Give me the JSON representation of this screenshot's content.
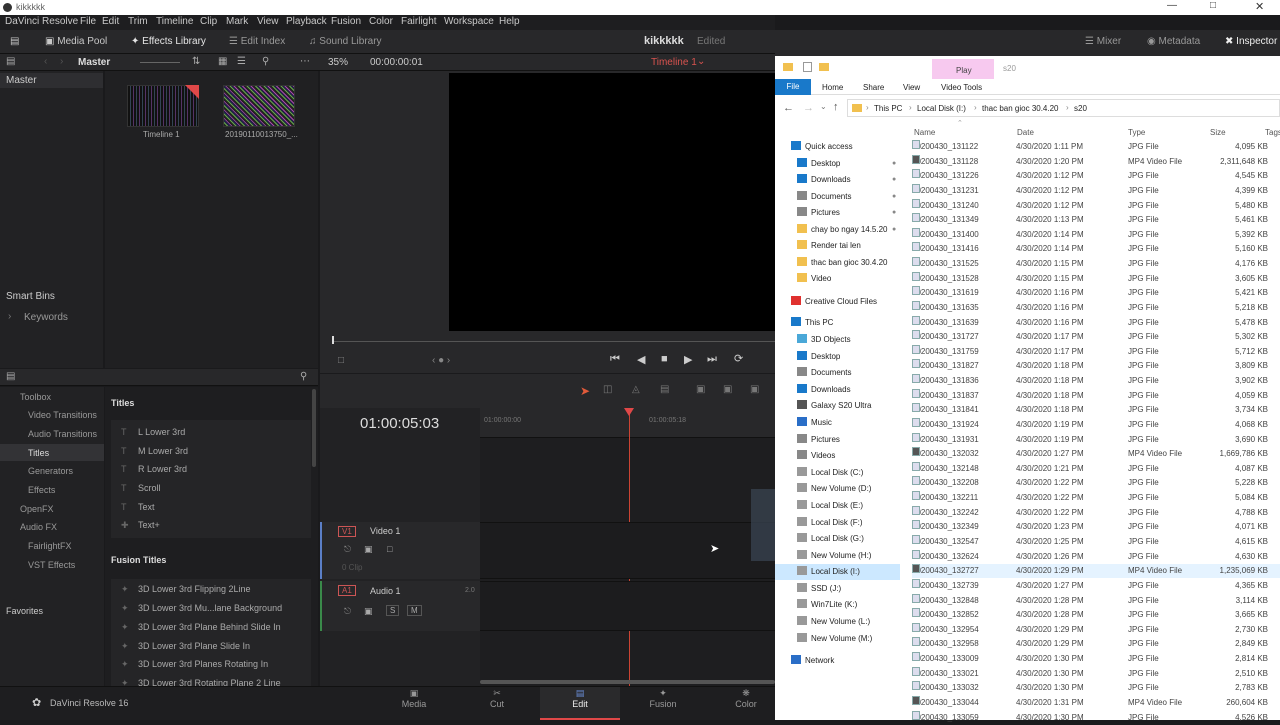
{
  "window_title": "kikkkkk",
  "menu": [
    "DaVinci Resolve",
    "File",
    "Edit",
    "Trim",
    "Timeline",
    "Clip",
    "Mark",
    "View",
    "Playback",
    "Fusion",
    "Color",
    "Fairlight",
    "Workspace",
    "Help"
  ],
  "toolbar": {
    "media_pool": "Media Pool",
    "effects_library": "Effects Library",
    "edit_index": "Edit Index",
    "sound_library": "Sound Library",
    "project_name": "kikkkkk",
    "project_status": "Edited",
    "mixer": "Mixer",
    "metadata": "Metadata",
    "inspector": "Inspector"
  },
  "mediapool": {
    "bin": "Master",
    "zoom": "35%",
    "timecode": "00:00:00:01",
    "timeline_name": "Timeline 1",
    "tree_master": "Master",
    "clip1": "Timeline 1",
    "clip2": "20190110013750_...",
    "smart_bins": "Smart Bins",
    "keywords": "Keywords"
  },
  "effects": {
    "toolbox": "Toolbox",
    "video_transitions": "Video Transitions",
    "audio_transitions": "Audio Transitions",
    "titles": "Titles",
    "generators": "Generators",
    "effects": "Effects",
    "openfx": "OpenFX",
    "audiofx": "Audio FX",
    "fairlightfx": "FairlightFX",
    "vst": "VST Effects",
    "favorites": "Favorites",
    "titles_header": "Titles",
    "title_items": [
      "L Lower 3rd",
      "M Lower 3rd",
      "R Lower 3rd",
      "Scroll",
      "Text",
      "Text+"
    ],
    "fusion_header": "Fusion Titles",
    "fusion_items": [
      "3D Lower 3rd Flipping 2Line",
      "3D Lower 3rd Mu...lane Background",
      "3D Lower 3rd Plane Behind Slide In",
      "3D Lower 3rd Plane Slide In",
      "3D Lower 3rd Planes Rotating In",
      "3D Lower 3rd Rotating Plane 2 Line"
    ]
  },
  "timeline": {
    "timecode": "01:00:05:03",
    "ruler_start": "01:00:00:00",
    "ruler_mark": "01:00:05:18",
    "v1": "V1",
    "video1": "Video 1",
    "clips_count": "0 Clip",
    "a1": "A1",
    "audio1": "Audio 1",
    "audio_level": "2.0",
    "s_btn": "S",
    "m_btn": "M"
  },
  "pages": [
    "Media",
    "Cut",
    "Edit",
    "Fusion",
    "Color"
  ],
  "app_name": "DaVinci Resolve 16",
  "explorer": {
    "ribbon_tab_play": "Play",
    "ribbon_context": "s20",
    "tabs": [
      "File",
      "Home",
      "Share",
      "View",
      "Video Tools"
    ],
    "path": [
      "This PC",
      "Local Disk (I:)",
      "thac ban gioc 30.4.20",
      "s20"
    ],
    "columns": [
      "Name",
      "Date",
      "Type",
      "Size",
      "Tags"
    ],
    "nav": [
      "Quick access",
      "Desktop",
      "Downloads",
      "Documents",
      "Pictures",
      "chay bo ngay 14.5.20",
      "Render tai len",
      "thac ban gioc 30.4.20",
      "Video",
      "Creative Cloud Files",
      "This PC",
      "3D Objects",
      "Desktop",
      "Documents",
      "Downloads",
      "Galaxy S20 Ultra",
      "Music",
      "Pictures",
      "Videos",
      "Local Disk (C:)",
      "New Volume (D:)",
      "Local Disk (E:)",
      "Local Disk (F:)",
      "Local Disk (G:)",
      "New Volume (H:)",
      "Local Disk (I:)",
      "SSD (J:)",
      "Win7Lite (K:)",
      "New Volume (L:)",
      "New Volume (M:)",
      "Network"
    ],
    "files": [
      [
        "20200430_131122",
        "4/30/2020 1:11 PM",
        "JPG File",
        "4,095 KB"
      ],
      [
        "20200430_131128",
        "4/30/2020 1:20 PM",
        "MP4 Video File",
        "2,311,648 KB"
      ],
      [
        "20200430_131226",
        "4/30/2020 1:12 PM",
        "JPG File",
        "4,545 KB"
      ],
      [
        "20200430_131231",
        "4/30/2020 1:12 PM",
        "JPG File",
        "4,399 KB"
      ],
      [
        "20200430_131240",
        "4/30/2020 1:12 PM",
        "JPG File",
        "5,480 KB"
      ],
      [
        "20200430_131349",
        "4/30/2020 1:13 PM",
        "JPG File",
        "5,461 KB"
      ],
      [
        "20200430_131400",
        "4/30/2020 1:14 PM",
        "JPG File",
        "5,392 KB"
      ],
      [
        "20200430_131416",
        "4/30/2020 1:14 PM",
        "JPG File",
        "5,160 KB"
      ],
      [
        "20200430_131525",
        "4/30/2020 1:15 PM",
        "JPG File",
        "4,176 KB"
      ],
      [
        "20200430_131528",
        "4/30/2020 1:15 PM",
        "JPG File",
        "3,605 KB"
      ],
      [
        "20200430_131619",
        "4/30/2020 1:16 PM",
        "JPG File",
        "5,421 KB"
      ],
      [
        "20200430_131635",
        "4/30/2020 1:16 PM",
        "JPG File",
        "5,218 KB"
      ],
      [
        "20200430_131639",
        "4/30/2020 1:16 PM",
        "JPG File",
        "5,478 KB"
      ],
      [
        "20200430_131727",
        "4/30/2020 1:17 PM",
        "JPG File",
        "5,302 KB"
      ],
      [
        "20200430_131759",
        "4/30/2020 1:17 PM",
        "JPG File",
        "5,712 KB"
      ],
      [
        "20200430_131827",
        "4/30/2020 1:18 PM",
        "JPG File",
        "3,809 KB"
      ],
      [
        "20200430_131836",
        "4/30/2020 1:18 PM",
        "JPG File",
        "3,902 KB"
      ],
      [
        "20200430_131837",
        "4/30/2020 1:18 PM",
        "JPG File",
        "4,059 KB"
      ],
      [
        "20200430_131841",
        "4/30/2020 1:18 PM",
        "JPG File",
        "3,734 KB"
      ],
      [
        "20200430_131924",
        "4/30/2020 1:19 PM",
        "JPG File",
        "4,068 KB"
      ],
      [
        "20200430_131931",
        "4/30/2020 1:19 PM",
        "JPG File",
        "3,690 KB"
      ],
      [
        "20200430_132032",
        "4/30/2020 1:27 PM",
        "MP4 Video File",
        "1,669,786 KB"
      ],
      [
        "20200430_132148",
        "4/30/2020 1:21 PM",
        "JPG File",
        "4,087 KB"
      ],
      [
        "20200430_132208",
        "4/30/2020 1:22 PM",
        "JPG File",
        "5,228 KB"
      ],
      [
        "20200430_132211",
        "4/30/2020 1:22 PM",
        "JPG File",
        "5,084 KB"
      ],
      [
        "20200430_132242",
        "4/30/2020 1:22 PM",
        "JPG File",
        "4,788 KB"
      ],
      [
        "20200430_132349",
        "4/30/2020 1:23 PM",
        "JPG File",
        "4,071 KB"
      ],
      [
        "20200430_132547",
        "4/30/2020 1:25 PM",
        "JPG File",
        "4,615 KB"
      ],
      [
        "20200430_132624",
        "4/30/2020 1:26 PM",
        "JPG File",
        "4,630 KB"
      ],
      [
        "20200430_132727",
        "4/30/2020 1:29 PM",
        "MP4 Video File",
        "1,235,069 KB"
      ],
      [
        "20200430_132739",
        "4/30/2020 1:27 PM",
        "JPG File",
        "4,365 KB"
      ],
      [
        "20200430_132848",
        "4/30/2020 1:28 PM",
        "JPG File",
        "3,114 KB"
      ],
      [
        "20200430_132852",
        "4/30/2020 1:28 PM",
        "JPG File",
        "3,665 KB"
      ],
      [
        "20200430_132954",
        "4/30/2020 1:29 PM",
        "JPG File",
        "2,730 KB"
      ],
      [
        "20200430_132958",
        "4/30/2020 1:29 PM",
        "JPG File",
        "2,849 KB"
      ],
      [
        "20200430_133009",
        "4/30/2020 1:30 PM",
        "JPG File",
        "2,814 KB"
      ],
      [
        "20200430_133021",
        "4/30/2020 1:30 PM",
        "JPG File",
        "2,510 KB"
      ],
      [
        "20200430_133032",
        "4/30/2020 1:30 PM",
        "JPG File",
        "2,783 KB"
      ],
      [
        "20200430_133044",
        "4/30/2020 1:31 PM",
        "MP4 Video File",
        "260,604 KB"
      ],
      [
        "20200430_133059",
        "4/30/2020 1:30 PM",
        "JPG File",
        "4,526 KB"
      ]
    ]
  }
}
